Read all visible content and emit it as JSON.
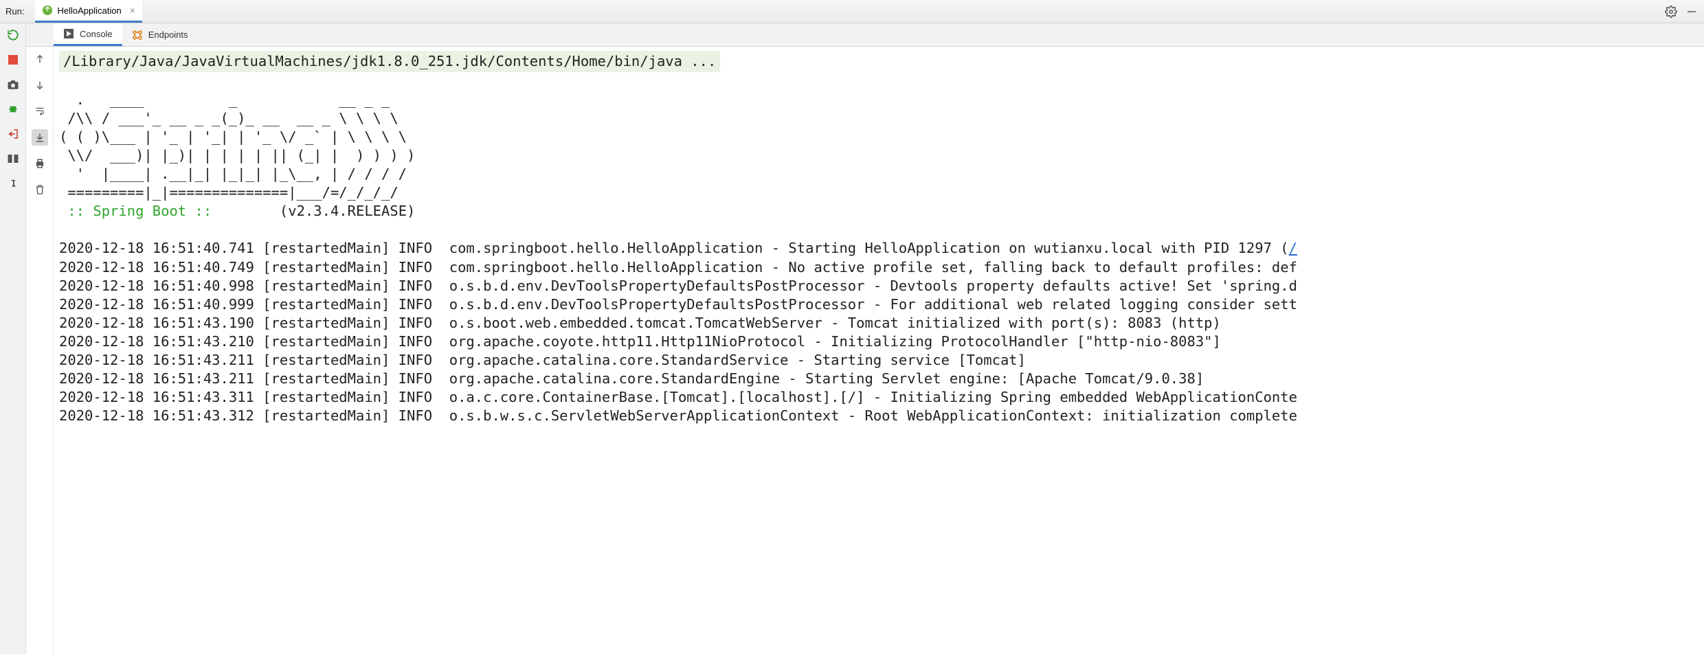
{
  "header": {
    "run_label": "Run:",
    "config_name": "HelloApplication"
  },
  "tabs": {
    "console": "Console",
    "endpoints": "Endpoints"
  },
  "console": {
    "command": "/Library/Java/JavaVirtualMachines/jdk1.8.0_251.jdk/Contents/Home/bin/java ...",
    "banner": [
      "  .   ____          _            __ _ _",
      " /\\\\ / ___'_ __ _ _(_)_ __  __ _ \\ \\ \\ \\",
      "( ( )\\___ | '_ | '_| | '_ \\/ _` | \\ \\ \\ \\",
      " \\\\/  ___)| |_)| | | | | || (_| |  ) ) ) )",
      "  '  |____| .__|_| |_|_| |_\\__, | / / / /",
      " =========|_|==============|___/=/_/_/_/"
    ],
    "spring_label": " :: Spring Boot ::",
    "spring_version": "        (v2.3.4.RELEASE)",
    "logs": [
      {
        "ts": "2020-12-18 16:51:40.741",
        "thread": "[restartedMain]",
        "level": "INFO",
        "logger": "com.springboot.hello.HelloApplication",
        "msg": "Starting HelloApplication on wutianxu.local with PID 1297 (",
        "link": "/"
      },
      {
        "ts": "2020-12-18 16:51:40.749",
        "thread": "[restartedMain]",
        "level": "INFO",
        "logger": "com.springboot.hello.HelloApplication",
        "msg": "No active profile set, falling back to default profiles: def"
      },
      {
        "ts": "2020-12-18 16:51:40.998",
        "thread": "[restartedMain]",
        "level": "INFO",
        "logger": "o.s.b.d.env.DevToolsPropertyDefaultsPostProcessor",
        "msg": "Devtools property defaults active! Set 'spring.d"
      },
      {
        "ts": "2020-12-18 16:51:40.999",
        "thread": "[restartedMain]",
        "level": "INFO",
        "logger": "o.s.b.d.env.DevToolsPropertyDefaultsPostProcessor",
        "msg": "For additional web related logging consider sett"
      },
      {
        "ts": "2020-12-18 16:51:43.190",
        "thread": "[restartedMain]",
        "level": "INFO",
        "logger": "o.s.boot.web.embedded.tomcat.TomcatWebServer",
        "msg": "Tomcat initialized with port(s): 8083 (http)"
      },
      {
        "ts": "2020-12-18 16:51:43.210",
        "thread": "[restartedMain]",
        "level": "INFO",
        "logger": "org.apache.coyote.http11.Http11NioProtocol",
        "msg": "Initializing ProtocolHandler [\"http-nio-8083\"]"
      },
      {
        "ts": "2020-12-18 16:51:43.211",
        "thread": "[restartedMain]",
        "level": "INFO",
        "logger": "org.apache.catalina.core.StandardService",
        "msg": "Starting service [Tomcat]"
      },
      {
        "ts": "2020-12-18 16:51:43.211",
        "thread": "[restartedMain]",
        "level": "INFO",
        "logger": "org.apache.catalina.core.StandardEngine",
        "msg": "Starting Servlet engine: [Apache Tomcat/9.0.38]"
      },
      {
        "ts": "2020-12-18 16:51:43.311",
        "thread": "[restartedMain]",
        "level": "INFO",
        "logger": "o.a.c.core.ContainerBase.[Tomcat].[localhost].[/]",
        "msg": "Initializing Spring embedded WebApplicationConte"
      },
      {
        "ts": "2020-12-18 16:51:43.312",
        "thread": "[restartedMain]",
        "level": "INFO",
        "logger": "o.s.b.w.s.c.ServletWebServerApplicationContext",
        "msg": "Root WebApplicationContext: initialization complete"
      }
    ]
  }
}
